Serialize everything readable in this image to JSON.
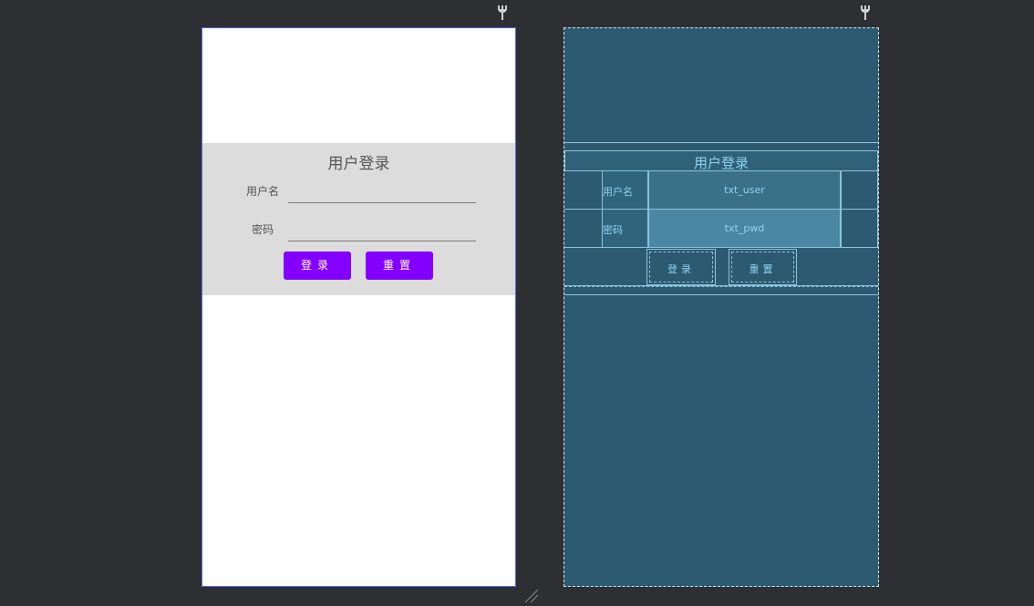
{
  "design": {
    "title": "用户登录",
    "username_label": "用户名",
    "password_label": "密码",
    "login_button": "登录",
    "reset_button": "重置"
  },
  "blueprint": {
    "title": "用户登录",
    "username_label": "用户名",
    "password_label": "密码",
    "user_field_id": "txt_user",
    "pwd_field_id": "txt_pwd",
    "login_button": "登录",
    "reset_button": "重置"
  },
  "icons": [
    "wrench-icon",
    "resize-handle-icon"
  ],
  "colors": {
    "canvas_bg": "#2e2f33",
    "design_bg": "#ffffff",
    "form_band": "#dcdcdc",
    "button_bg": "#8300ff",
    "blueprint_bg": "#2c5a70",
    "blueprint_line": "#8bc3dc"
  }
}
